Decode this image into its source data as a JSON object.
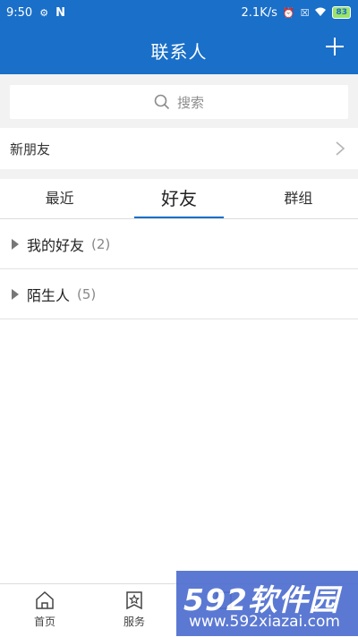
{
  "status_bar": {
    "time": "9:50",
    "left_icons": [
      "settings-dot-icon",
      "n-app-icon"
    ],
    "net_speed": "2.1K/s",
    "right_icons": [
      "alarm-icon",
      "sim-x-icon",
      "wifi-icon"
    ],
    "battery": "83"
  },
  "header": {
    "title": "联系人",
    "add_icon": "plus-icon"
  },
  "search": {
    "placeholder": "搜索",
    "icon": "search-icon"
  },
  "new_friends": {
    "label": "新朋友",
    "icon": "chevron-right-icon"
  },
  "tabs": [
    {
      "label": "最近",
      "active": false
    },
    {
      "label": "好友",
      "active": true
    },
    {
      "label": "群组",
      "active": false
    }
  ],
  "groups": [
    {
      "name": "我的好友",
      "count": "(2)"
    },
    {
      "name": "陌生人",
      "count": "(5)"
    }
  ],
  "bottom_nav": [
    {
      "label": "首页",
      "icon": "home-icon"
    },
    {
      "label": "服务",
      "icon": "service-star-icon"
    },
    {
      "label": "",
      "icon": "contacts-icon"
    }
  ],
  "watermark": {
    "brand": "592软件园",
    "url": "www.592xiazai.com"
  },
  "colors": {
    "primary": "#1a6fc8",
    "background": "#f2f2f2",
    "watermark": "#4f6fd0"
  }
}
